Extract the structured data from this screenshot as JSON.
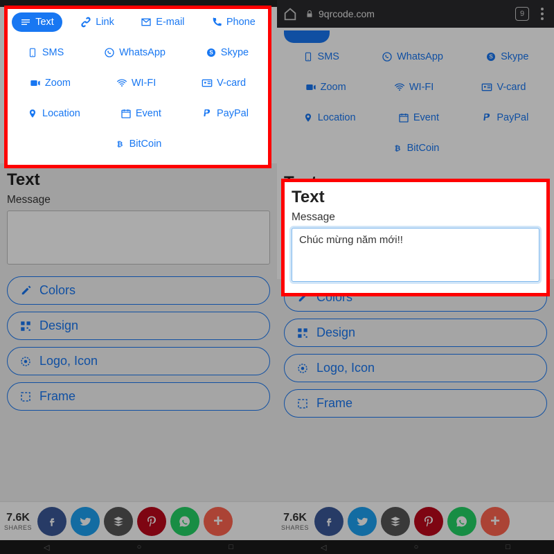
{
  "browser": {
    "url_host": "9qrcode.com",
    "tab_count": "9"
  },
  "types": {
    "text": "Text",
    "link": "Link",
    "email": "E-mail",
    "phone": "Phone",
    "sms": "SMS",
    "whatsapp": "WhatsApp",
    "skype": "Skype",
    "zoom": "Zoom",
    "wifi": "WI-FI",
    "vcard": "V-card",
    "location": "Location",
    "event": "Event",
    "paypal": "PayPal",
    "bitcoin": "BitCoin"
  },
  "section": {
    "title": "Text",
    "message_label": "Message",
    "message_value": "Chúc mừng năm mới!!"
  },
  "options": {
    "colors": "Colors",
    "design": "Design",
    "logo": "Logo, Icon",
    "frame": "Frame"
  },
  "share": {
    "count": "7.6K",
    "label": "SHARES",
    "more": "+"
  }
}
